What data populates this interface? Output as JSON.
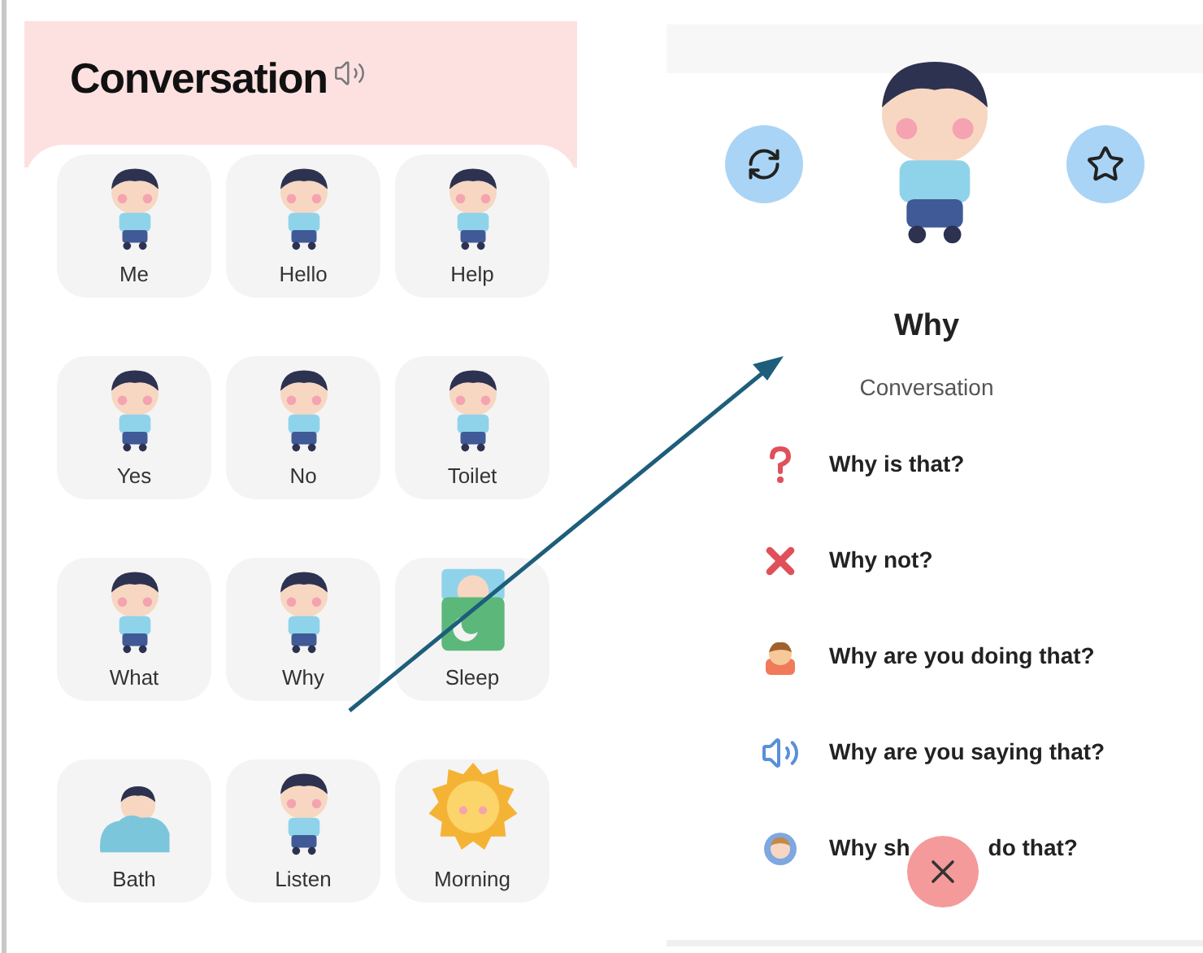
{
  "category_screen": {
    "title": "Conversation",
    "cards": [
      {
        "label": "Me",
        "kind": "kid"
      },
      {
        "label": "Hello",
        "kind": "kid"
      },
      {
        "label": "Help",
        "kind": "kid"
      },
      {
        "label": "Yes",
        "kind": "kid"
      },
      {
        "label": "No",
        "kind": "kid"
      },
      {
        "label": "Toilet",
        "kind": "kid"
      },
      {
        "label": "What",
        "kind": "kid"
      },
      {
        "label": "Why",
        "kind": "kid"
      },
      {
        "label": "Sleep",
        "kind": "sleep"
      },
      {
        "label": "Bath",
        "kind": "bath"
      },
      {
        "label": "Listen",
        "kind": "kid"
      },
      {
        "label": "Morning",
        "kind": "sun"
      }
    ]
  },
  "detail_screen": {
    "word": "Why",
    "category": "Conversation",
    "phrases": [
      {
        "text": "Why is that?",
        "kind": "question"
      },
      {
        "text": "Why not?",
        "kind": "cross"
      },
      {
        "text": "Why are you doing that?",
        "kind": "person"
      },
      {
        "text": "Why are you saying that?",
        "kind": "speaker"
      },
      {
        "text": "Why sh",
        "text_after": "do that?",
        "kind": "person2"
      }
    ]
  }
}
